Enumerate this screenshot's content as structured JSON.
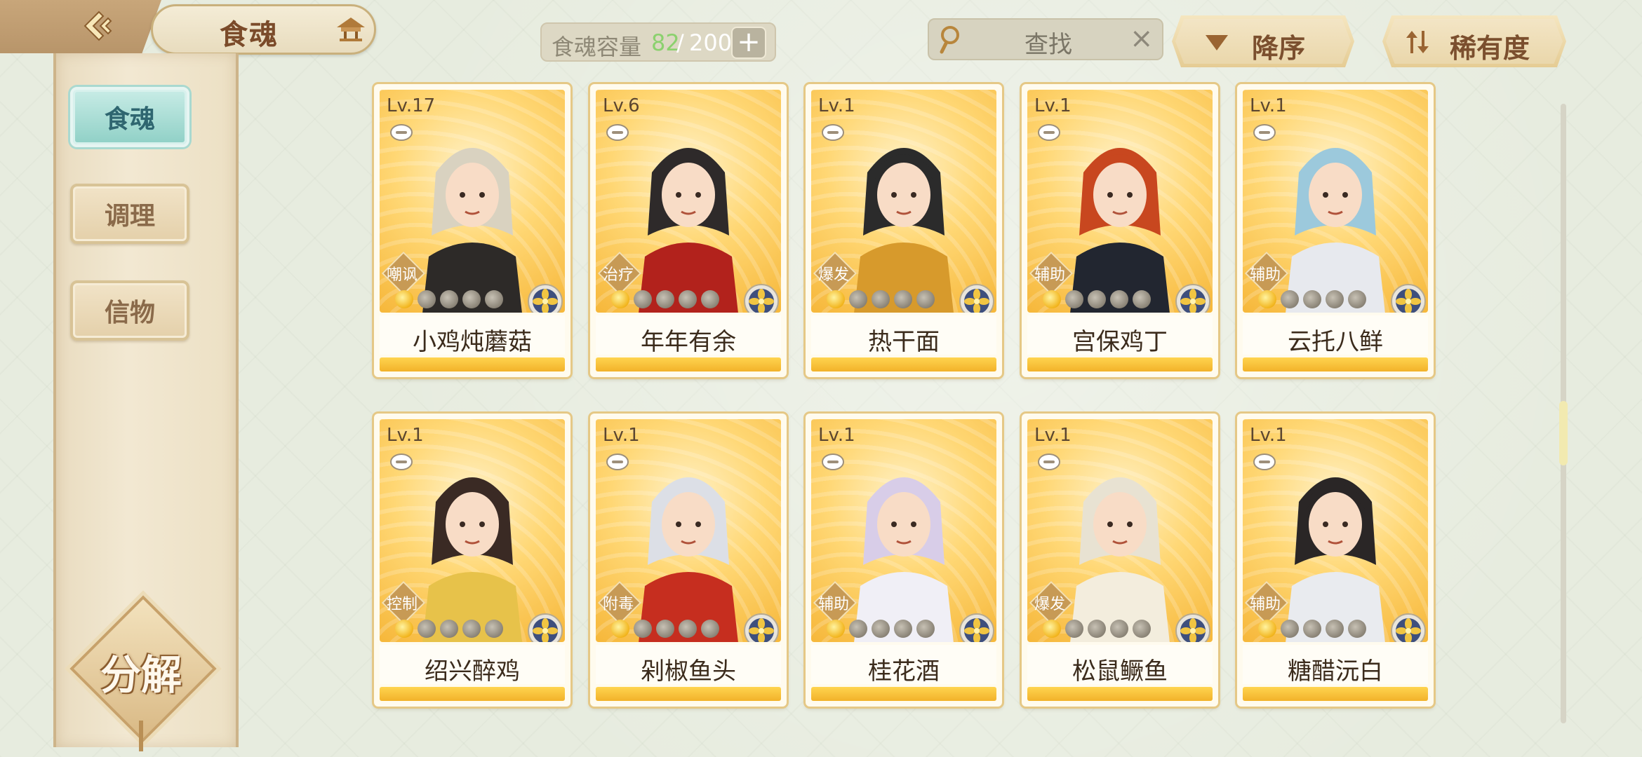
{
  "header": {
    "title": "食魂"
  },
  "sidebar": {
    "tabs": [
      {
        "label": "食魂",
        "active": true
      },
      {
        "label": "调理",
        "active": false
      },
      {
        "label": "信物",
        "active": false
      }
    ],
    "decompose_label": "分解"
  },
  "capacity": {
    "label": "食魂容量",
    "current": "82",
    "separator": "/",
    "max": "200",
    "plus": "+"
  },
  "search": {
    "placeholder": "查找",
    "clear": "×"
  },
  "sort": {
    "order_label": "降序",
    "rarity_label": "稀有度"
  },
  "cards": [
    {
      "level": "Lv.17",
      "role": "嘲讽",
      "name": "小鸡炖蘑菇",
      "stars": 1,
      "element": "flower-icon"
    },
    {
      "level": "Lv.6",
      "role": "治疗",
      "name": "年年有余",
      "stars": 1,
      "element": "flower-icon"
    },
    {
      "level": "Lv.1",
      "role": "爆发",
      "name": "热干面",
      "stars": 1,
      "element": "flower-icon"
    },
    {
      "level": "Lv.1",
      "role": "辅助",
      "name": "宫保鸡丁",
      "stars": 1,
      "element": "flower-icon"
    },
    {
      "level": "Lv.1",
      "role": "辅助",
      "name": "云托八鲜",
      "stars": 1,
      "element": "flower-icon"
    },
    {
      "level": "Lv.1",
      "role": "控制",
      "name": "绍兴醉鸡",
      "stars": 1,
      "element": "flower-icon"
    },
    {
      "level": "Lv.1",
      "role": "附毒",
      "name": "剁椒鱼头",
      "stars": 1,
      "element": "flower-icon"
    },
    {
      "level": "Lv.1",
      "role": "辅助",
      "name": "桂花酒",
      "stars": 1,
      "element": "flower-icon"
    },
    {
      "level": "Lv.1",
      "role": "爆发",
      "name": "松鼠鳜鱼",
      "stars": 1,
      "element": "flower-icon"
    },
    {
      "level": "Lv.1",
      "role": "辅助",
      "name": "糖醋沅白",
      "stars": 1,
      "element": "flower-icon"
    }
  ],
  "colors": {
    "accent_teal": "#8fd0c6",
    "card_gold": "#f6b73a",
    "capacity_green": "#8bd16e",
    "brown_text": "#7b4b2a"
  }
}
